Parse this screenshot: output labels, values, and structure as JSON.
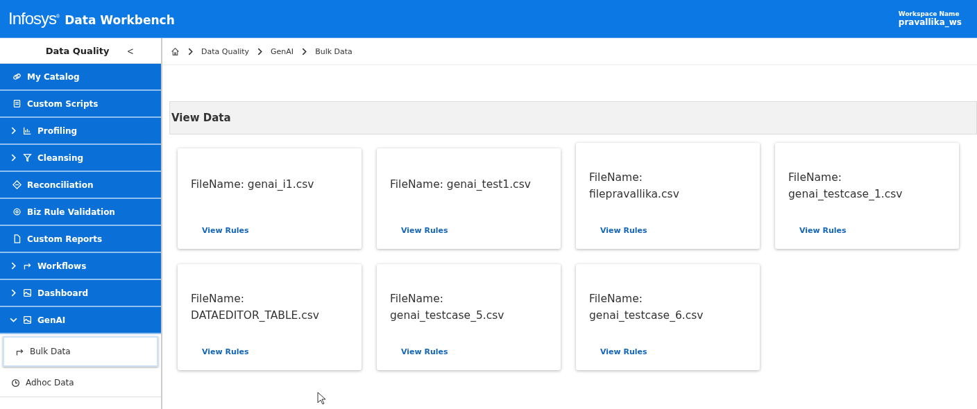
{
  "header": {
    "logo": "Infosys",
    "logo_mark": "®",
    "title": "Data Workbench",
    "workspace_label": "Workspace Name",
    "workspace": "pravallika_ws"
  },
  "sidebar": {
    "title": "Data Quality",
    "collapse": "<",
    "items": [
      {
        "label": "My Catalog",
        "kind": "link"
      },
      {
        "label": "Custom Scripts",
        "kind": "link"
      },
      {
        "label": "Profiling",
        "kind": "group",
        "expanded": false
      },
      {
        "label": "Cleansing",
        "kind": "group",
        "expanded": false
      },
      {
        "label": "Reconciliation",
        "kind": "link"
      },
      {
        "label": "Biz Rule Validation",
        "kind": "link"
      },
      {
        "label": "Custom Reports",
        "kind": "link"
      },
      {
        "label": "Workflows",
        "kind": "group",
        "expanded": false
      },
      {
        "label": "Dashboard",
        "kind": "group",
        "expanded": false
      },
      {
        "label": "GenAI",
        "kind": "group",
        "expanded": true,
        "children": [
          {
            "label": "Bulk Data",
            "selected": true
          },
          {
            "label": "Adhoc Data",
            "selected": false
          }
        ]
      }
    ]
  },
  "breadcrumb": [
    "Data Quality",
    "GenAI",
    "Bulk Data"
  ],
  "section_title": "View Data",
  "cards": [
    {
      "lines": [
        "FileName: genai_i1.csv"
      ],
      "link": "View Rules"
    },
    {
      "lines": [
        "FileName: genai_test1.csv"
      ],
      "link": "View Rules"
    },
    {
      "lines": [
        "FileName:",
        "filepravallika.csv"
      ],
      "link": "View Rules"
    },
    {
      "lines": [
        "FileName:",
        "genai_testcase_1.csv"
      ],
      "link": "View Rules"
    },
    {
      "lines": [
        "FileName:",
        "DATAEDITOR_TABLE.csv"
      ],
      "link": "View Rules"
    },
    {
      "lines": [
        "FileName:",
        "genai_testcase_5.csv"
      ],
      "link": "View Rules"
    },
    {
      "lines": [
        "FileName:",
        "genai_testcase_6.csv"
      ],
      "link": "View Rules"
    }
  ]
}
